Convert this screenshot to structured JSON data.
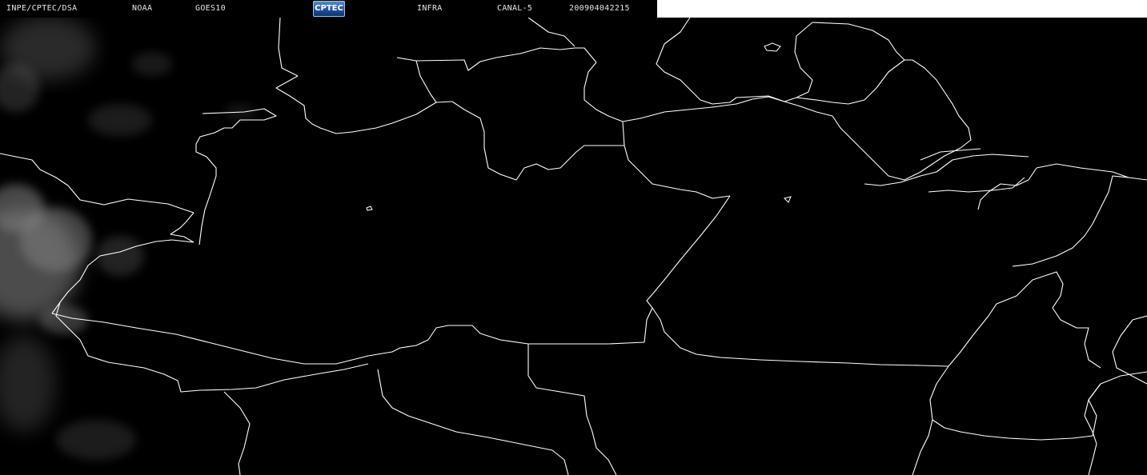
{
  "header": {
    "institution": "INPE/CPTEC/DSA",
    "agency": "NOAA",
    "satellite": "GOES10",
    "logo_text": "CPTEC",
    "product": "INFRA",
    "channel": "CANAL-5",
    "timestamp": "200904042215"
  },
  "colors": {
    "background": "#000000",
    "borders": "#ffffff",
    "clouds": "#8a8a8a",
    "header_blank": "#ffffff"
  }
}
